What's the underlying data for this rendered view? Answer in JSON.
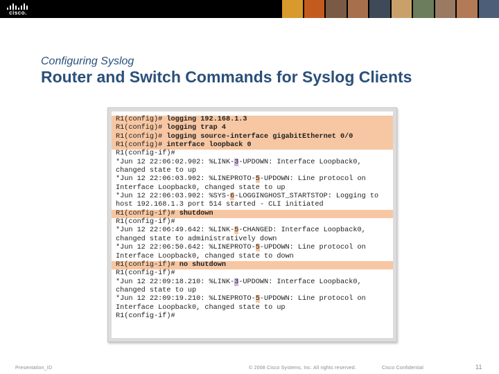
{
  "header": {
    "logo_text": "cisco.",
    "photo_strip": [
      "#d89a2c",
      "#c45b1e",
      "#7a5a44",
      "#a86f4c",
      "#3f4a58",
      "#caa06a",
      "#6b7d5c",
      "#9a7b62",
      "#b37a58",
      "#4d5f78"
    ]
  },
  "slide": {
    "subtitle": "Configuring Syslog",
    "title": "Router and Switch Commands for Syslog Clients"
  },
  "console": {
    "lines": [
      {
        "type": "cmd",
        "prompt": "R1(config)# ",
        "text": "logging 192.168.1.3"
      },
      {
        "type": "cmd",
        "prompt": "R1(config)# ",
        "text": "logging trap 4"
      },
      {
        "type": "cmd",
        "prompt": "R1(config)# ",
        "text": "logging source-interface gigabitEthernet 0/0"
      },
      {
        "type": "cmd",
        "prompt": "R1(config)# ",
        "text": "interface loopback 0"
      },
      {
        "type": "plain",
        "parts": [
          {
            "t": "R1(config-if)#"
          }
        ]
      },
      {
        "type": "plain",
        "parts": [
          {
            "t": "*Jun 12 22:06:02.902: %LINK-"
          },
          {
            "t": "3",
            "hl": "purple"
          },
          {
            "t": "-UPDOWN: Interface Loopback0,"
          }
        ]
      },
      {
        "type": "plain",
        "parts": [
          {
            "t": "changed state to up"
          }
        ]
      },
      {
        "type": "plain",
        "parts": [
          {
            "t": "*Jun 12 22:06:03.902: %LINEPROTO-"
          },
          {
            "t": "5",
            "hl": "orange"
          },
          {
            "t": "-UPDOWN: Line protocol on"
          }
        ]
      },
      {
        "type": "plain",
        "parts": [
          {
            "t": "Interface Loopback0, changed state to up"
          }
        ]
      },
      {
        "type": "plain",
        "parts": [
          {
            "t": "*Jun 12 22:06:03.902: %SYS-"
          },
          {
            "t": "6",
            "hl": "orange"
          },
          {
            "t": "-LOGGINGHOST_STARTSTOP: Logging to"
          }
        ]
      },
      {
        "type": "plain",
        "parts": [
          {
            "t": "host 192.168.1.3 port 514 started - CLI initiated"
          }
        ]
      },
      {
        "type": "cmd",
        "prompt": "R1(config-if)# ",
        "text": "shutdown"
      },
      {
        "type": "plain",
        "parts": [
          {
            "t": "R1(config-if)#"
          }
        ]
      },
      {
        "type": "plain",
        "parts": [
          {
            "t": "*Jun 12 22:06:49.642: %LINK-"
          },
          {
            "t": "5",
            "hl": "orange"
          },
          {
            "t": "-CHANGED: Interface Loopback0,"
          }
        ]
      },
      {
        "type": "plain",
        "parts": [
          {
            "t": "changed state to administratively down"
          }
        ]
      },
      {
        "type": "plain",
        "parts": [
          {
            "t": "*Jun 12 22:06:50.642: %LINEPROTO-"
          },
          {
            "t": "5",
            "hl": "orange"
          },
          {
            "t": "-UPDOWN: Line protocol on"
          }
        ]
      },
      {
        "type": "plain",
        "parts": [
          {
            "t": "Interface Loopback0, changed state to down"
          }
        ]
      },
      {
        "type": "cmd",
        "prompt": "R1(config-if)# ",
        "text": "no shutdown"
      },
      {
        "type": "plain",
        "parts": [
          {
            "t": "R1(config-if)#"
          }
        ]
      },
      {
        "type": "plain",
        "parts": [
          {
            "t": "*Jun 12 22:09:18.210: %LINK-"
          },
          {
            "t": "3",
            "hl": "purple"
          },
          {
            "t": "-UPDOWN: Interface Loopback0,"
          }
        ]
      },
      {
        "type": "plain",
        "parts": [
          {
            "t": "changed state to up"
          }
        ]
      },
      {
        "type": "plain",
        "parts": [
          {
            "t": "*Jun 12 22:09:19.210: %LINEPROTO-"
          },
          {
            "t": "5",
            "hl": "orange"
          },
          {
            "t": "-UPDOWN: Line protocol on"
          }
        ]
      },
      {
        "type": "plain",
        "parts": [
          {
            "t": "Interface Loopback0, changed state to up"
          }
        ]
      },
      {
        "type": "plain",
        "parts": [
          {
            "t": "R1(config-if)#"
          }
        ]
      }
    ]
  },
  "footer": {
    "left": "Presentation_ID",
    "center": "© 2008 Cisco Systems, Inc. All rights reserved.",
    "confidential": "Cisco Confidential",
    "page": "11"
  }
}
